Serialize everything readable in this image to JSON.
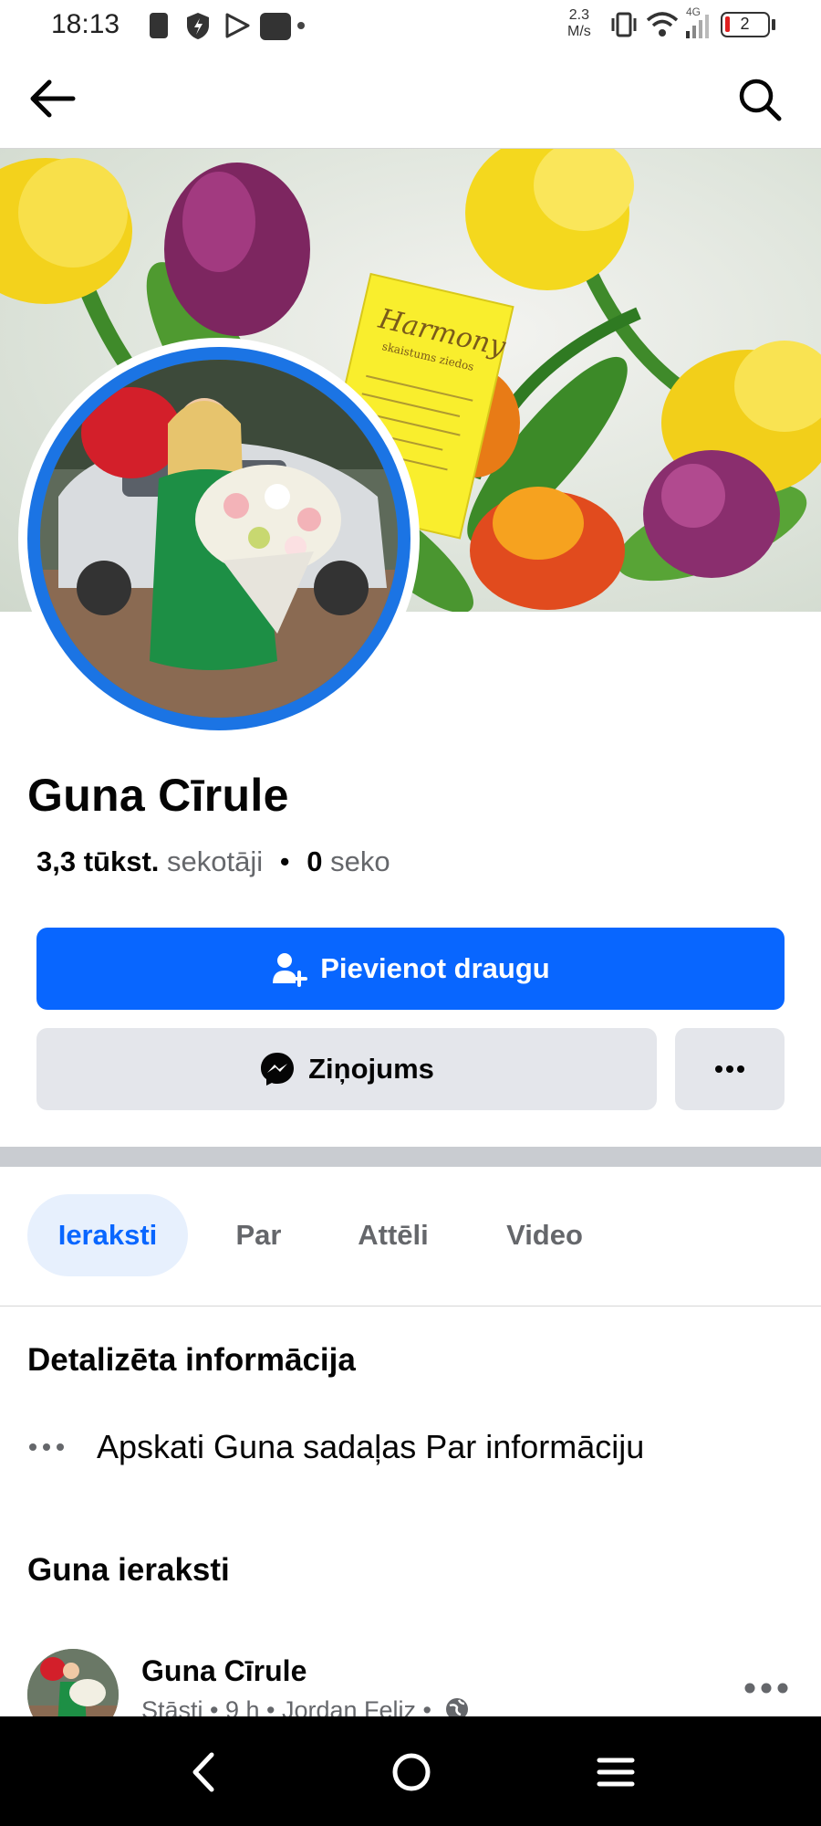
{
  "status_bar": {
    "time": "18:13",
    "speed_value": "2.3",
    "speed_unit": "M/s",
    "network": "4G",
    "battery": "2"
  },
  "profile": {
    "name": "Guna Cīrule",
    "followers_count": "3,3 tūkst.",
    "followers_label": "sekotāji",
    "separator": "•",
    "following_count": "0",
    "following_label": "seko"
  },
  "actions": {
    "add_friend": "Pievienot draugu",
    "message": "Ziņojums",
    "more": "···"
  },
  "tabs": [
    {
      "label": "Ieraksti",
      "active": true
    },
    {
      "label": "Par",
      "active": false
    },
    {
      "label": "Attēli",
      "active": false
    },
    {
      "label": "Video",
      "active": false
    }
  ],
  "details": {
    "title": "Detalizēta informācija",
    "item_text": "Apskati Guna sadaļas Par informāciju"
  },
  "posts": {
    "title": "Guna ieraksti",
    "first_post": {
      "author": "Guna Cīrule",
      "meta": "Stāsti • 9 h • Jordan Feliz •"
    }
  },
  "cover_card": {
    "brand": "Harmony",
    "subtitle": "skaistums ziedos"
  },
  "colors": {
    "accent": "#0866ff",
    "ring": "#1b74e4",
    "secondary_button": "#e4e6eb",
    "active_tab_bg": "#e7f0fd"
  },
  "icons": {
    "back": "arrow-left-icon",
    "search": "search-icon",
    "add_friend": "add-person-icon",
    "messenger": "messenger-icon",
    "more": "more-horizontal-icon",
    "globe": "globe-icon"
  }
}
